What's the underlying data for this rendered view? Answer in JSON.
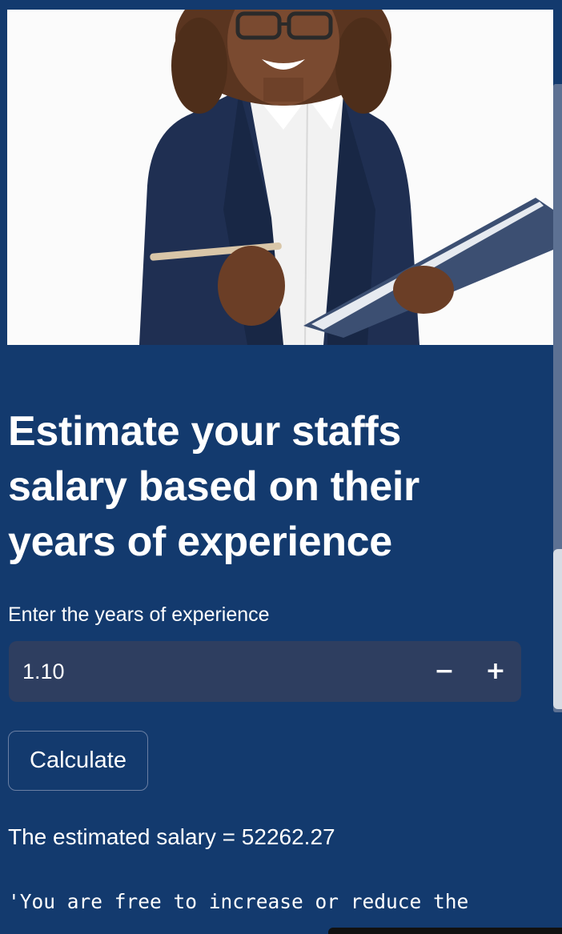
{
  "hero": {
    "icon": "businesswoman-photo"
  },
  "title": "Estimate your staffs salary based on their years of experience",
  "experience_input": {
    "label": "Enter the years of experience",
    "value": "1.10",
    "decrement": "−",
    "increment": "+"
  },
  "calculate_button": "Calculate",
  "result_text": "The estimated salary = 52262.27",
  "note_text": "'You are free to increase or reduce the",
  "colors": {
    "background": "#133a6e",
    "input_bg": "#2e3e60",
    "text": "#ffffff"
  }
}
